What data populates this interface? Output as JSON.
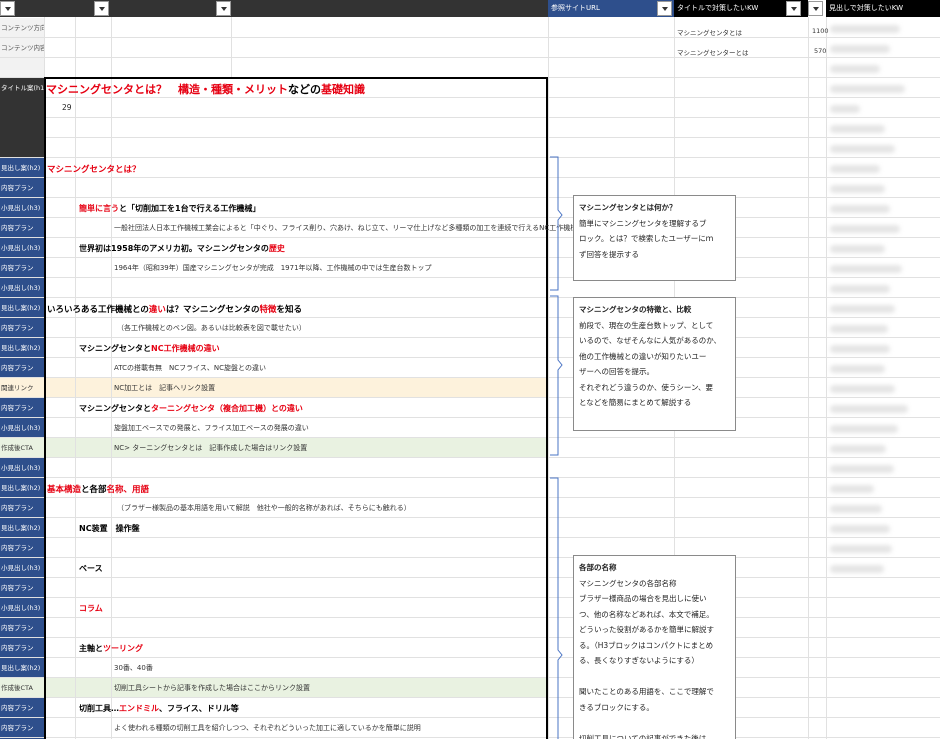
{
  "headers": {
    "ref_url": "参照サイトURL",
    "title_kw": "タイトルで対策したいKW",
    "heading_kw": "見出しで対策したいKW"
  },
  "keywords": [
    {
      "kw": "マシニングセンタとは",
      "volume": "1100"
    },
    {
      "kw": "マシニングセンターとは",
      "volume": "570"
    }
  ],
  "row_labels": {
    "content_direction": "コンテンツ方向性",
    "content_body": "コンテンツ内容",
    "title": "タイトル案(h1)",
    "h2": "見出し案(h2)",
    "h3": "小見出し(h3)",
    "plan": "内容プラン",
    "related_link": "関連リンク",
    "cta": "作成後CTA"
  },
  "title_row": {
    "part1": "マシニングセンタとは？",
    "part2": "構造・種類・メリット",
    "part3": "などの",
    "part4": "基礎知識",
    "char_count": "29"
  },
  "rows": {
    "r1": {
      "a": "マシニングセンタとは？"
    },
    "r3": {
      "a": "簡単に言う",
      "b": "と「切削加工を1台で行える工作機械」"
    },
    "r4": {
      "a": "一般社団法人日本工作機械工業会によると「中ぐり、フライス削り、穴あけ、ねじ立て、リーマ仕上げなど多種類の加工を連続で行えるNC工作機械」"
    },
    "r5": {
      "a": "世界初は1958年のアメリカ初。マシニングセンタの",
      "b": "歴史"
    },
    "r6": {
      "a": "1964年（昭和39年）国産マシニングセンタが完成　1971年以降、工作機械の中では生産台数トップ"
    },
    "r8": {
      "a": "いろいろある工作機械との",
      "b": "違い",
      "c": "は？マシニングセンタの",
      "d": "特徴",
      "e": "を知る"
    },
    "r9": {
      "a": "（各工作機械とのベン図。あるいは比較表を図で載せたい）"
    },
    "r10": {
      "a": "マシニングセンタと",
      "b": "NC工作機械の違い"
    },
    "r11": {
      "a": "ATCの搭載有無　NCフライス、NC旋盤との違い"
    },
    "r12": {
      "a": "NC加工とは　記事へリンク設置"
    },
    "r13": {
      "a": "マシニングセンタと",
      "b": "ターニングセンタ（複合加工機）との違い"
    },
    "r14": {
      "a": "旋盤加工ベースでの発展と、フライス加工ベースの発展の違い"
    },
    "r15": {
      "a": "NC> ターニングセンタとは　記事作成した場合はリンク設置"
    },
    "r17": {
      "a": "基本構造",
      "b": "と各部",
      "c": "名称、用語"
    },
    "r18": {
      "a": "（ブラザー様製品の基本用語を用いて解説　他社や一般的名称があれば、そちらにも触れる）"
    },
    "r19": {
      "a": "NC装置　操作盤"
    },
    "r21": {
      "a": "ベース"
    },
    "r23": {
      "a": "コラム"
    },
    "r25": {
      "a": "主軸と",
      "b": "ツーリング"
    },
    "r26": {
      "a": "30番、40番"
    },
    "r27": {
      "a": "切削工具シートから記事を作成した場合はここからリンク設置"
    },
    "r28": {
      "a": "切削工具…",
      "b": "エンドミル",
      "c": "、フライス、ドリル等"
    },
    "r29": {
      "a": "よく使われる種類の切削工具を紹介しつつ、それぞれどういった加工に適しているかを簡単に説明"
    }
  },
  "notes": [
    {
      "title": "マシニングセンタとは何か？",
      "lines": [
        "簡単にマシニングセンタを理解するブ",
        "ロック。とは？で検索したユーザーにｍ",
        "ず回答を提示する"
      ]
    },
    {
      "title": "マシニングセンタの特徴と、比較",
      "lines": [
        "前段で、現在の生産台数トップ、として",
        "いるので、なぜそんなに人気があるのか、",
        "他の工作機械との違いが知りたいユー",
        "ザーへの回答を提示。",
        "それぞれどう違うのか、使うシーン、要",
        "となどを簡易にまとめて解説する"
      ]
    },
    {
      "title": "各部の名称",
      "lines": [
        "マシニングセンタの各部名称",
        "ブラザー様商品の場合を見出しに使い",
        "つ、他の名称などあれば、本文で補足。",
        "どういった役割があるかを簡単に解説す",
        "る。（H3ブロックはコンパクトにまとめ",
        "る、長くなりすぎないようにする）",
        "",
        "聞いたことのある用語を、ここで理解で",
        "きるブロックにする。",
        "",
        "切削工具についての記事ができた後は"
      ]
    }
  ],
  "colors": {
    "label_blue": "#2e4f8c",
    "title_bg": "#333333",
    "related_bg": "#fdf2dc",
    "cta_bg": "#e9f2e1",
    "accent_red": "#e60012",
    "bracket_blue": "#4a74c4"
  }
}
